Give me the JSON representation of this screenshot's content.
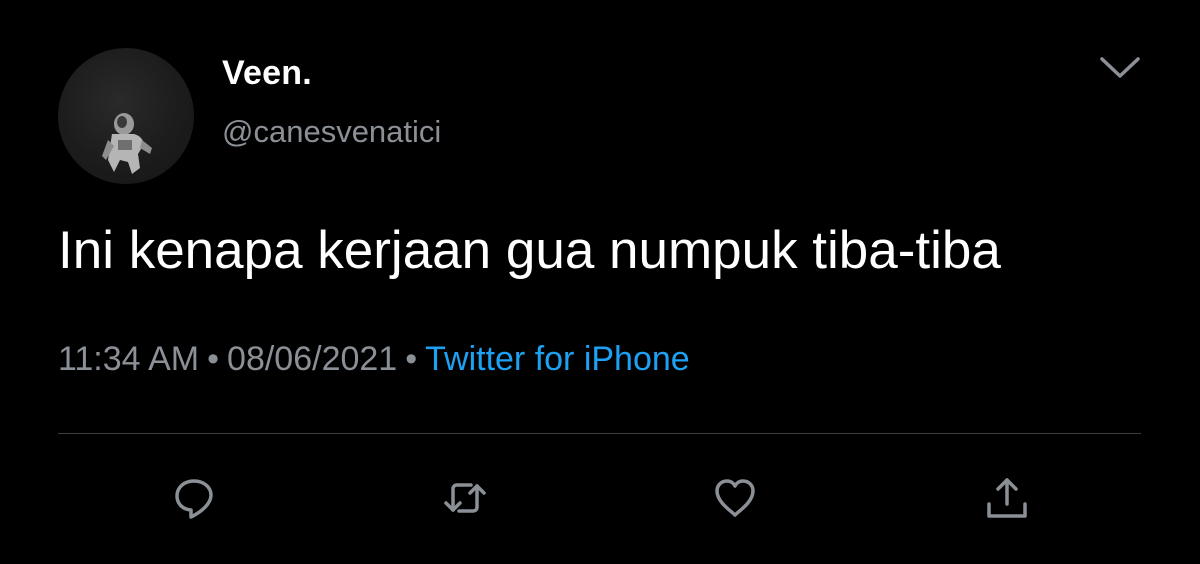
{
  "author": {
    "display_name": "Veen.",
    "handle": "@canesvenatici"
  },
  "tweet": {
    "text": "Ini kenapa kerjaan gua numpuk tiba-tiba",
    "time": "11:34 AM",
    "separator": "•",
    "date": "08/06/2021",
    "source": "Twitter for iPhone"
  },
  "icons": {
    "menu": "chevron-down-icon",
    "reply": "reply-icon",
    "retweet": "retweet-icon",
    "like": "heart-icon",
    "share": "share-icon"
  },
  "colors": {
    "background": "#000000",
    "text_primary": "#ffffff",
    "text_secondary": "#8b9096",
    "link": "#1da1f2",
    "icon": "#8b9096"
  }
}
